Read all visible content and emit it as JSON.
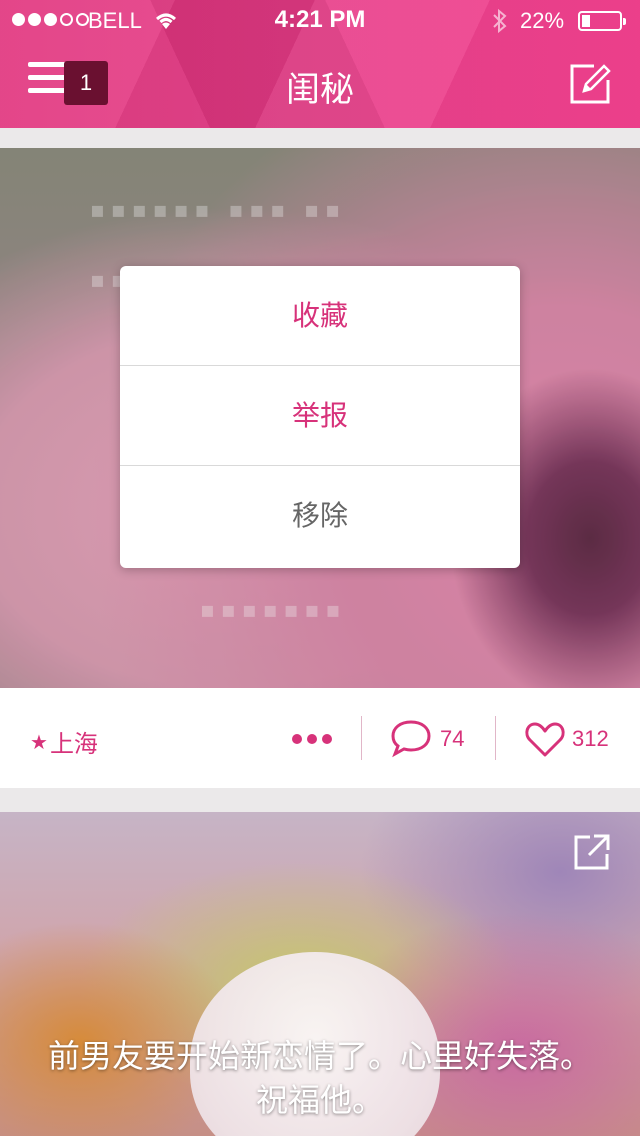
{
  "status_bar": {
    "carrier": "BELL",
    "time": "4:21 PM",
    "battery_percent": "22%",
    "battery_level": 0.22,
    "signal_filled": 3,
    "signal_total": 5
  },
  "header": {
    "title": "闺秘",
    "badge_count": "1",
    "menu_icon": "hamburger-menu-icon",
    "compose_icon": "compose-icon"
  },
  "action_sheet": {
    "items": [
      {
        "label": "收藏",
        "color": "#d7327a"
      },
      {
        "label": "举报",
        "color": "#d7327a"
      },
      {
        "label": "移除",
        "color": "#666666"
      }
    ]
  },
  "post1": {
    "location": "上海",
    "comments": "74",
    "likes": "312"
  },
  "post2": {
    "text": "前男友要开始新恋情了。心里好失落。祝福他。"
  },
  "colors": {
    "accent": "#e6397f",
    "pink_text": "#d7327a",
    "badge_bg": "#6a1030"
  }
}
